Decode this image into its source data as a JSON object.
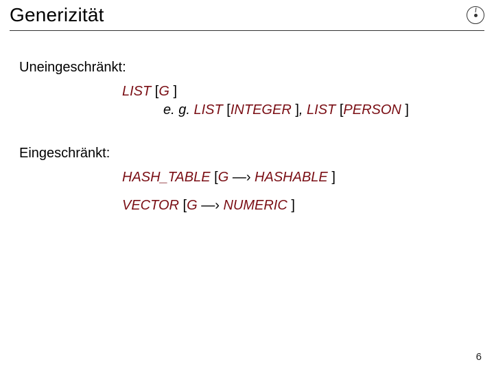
{
  "slide": {
    "title": "Generizität",
    "logo_name": "clock-circle-icon",
    "page_number": "6",
    "sections": {
      "unconstrained": {
        "label": "Uneingeschränkt:",
        "line1": {
          "list": "LIST",
          "open": " [",
          "g": "G",
          "close": " ]"
        },
        "line2": {
          "eg": "e. g. ",
          "list1": "LIST",
          "open1": " [",
          "type1": "INTEGER",
          "close1": " ]",
          "comma": ", ",
          "list2": "LIST",
          "open2": " [",
          "type2": "PERSON",
          "close2": " ]"
        }
      },
      "constrained": {
        "label": "Eingeschränkt:",
        "line1": {
          "class": "HASH_TABLE",
          "open": " [",
          "g": "G",
          "arrow": " —› ",
          "bound": "HASHABLE",
          "close": " ]"
        },
        "line2": {
          "class": "VECTOR",
          "open": " [",
          "g": "G",
          "arrow": " —› ",
          "bound": "NUMERIC",
          "close": " ]"
        }
      }
    }
  }
}
